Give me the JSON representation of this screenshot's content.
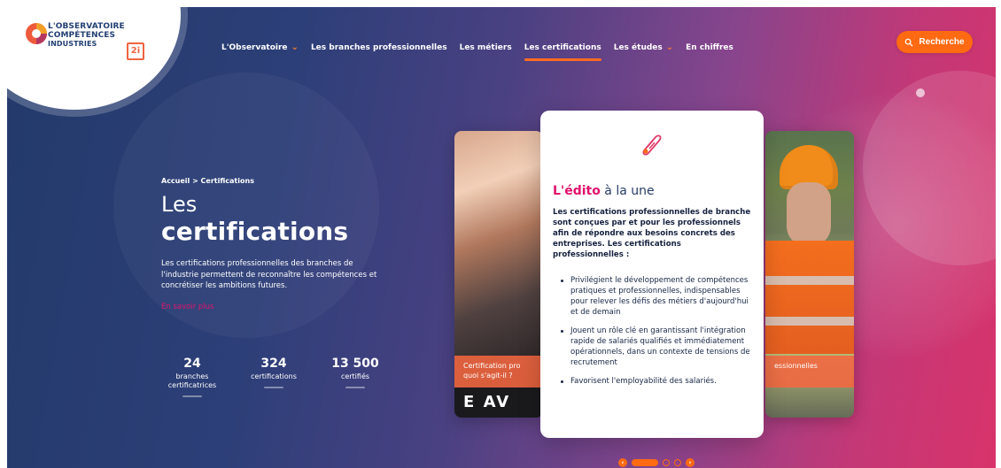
{
  "logo": {
    "line1": "L'OBSERVATOIRE",
    "line2": "COMPÉTENCES",
    "line3": "INDUSTRIES",
    "mark": "2i"
  },
  "nav": [
    {
      "label": "L'Observatoire",
      "has_chevron": true,
      "active": false
    },
    {
      "label": "Les branches professionnelles",
      "has_chevron": false,
      "active": false
    },
    {
      "label": "Les métiers",
      "has_chevron": false,
      "active": false
    },
    {
      "label": "Les certifications",
      "has_chevron": false,
      "active": true
    },
    {
      "label": "Les études",
      "has_chevron": true,
      "active": false
    },
    {
      "label": "En chiffres",
      "has_chevron": false,
      "active": false
    }
  ],
  "search": {
    "label": "Recherche",
    "icon": "search-icon"
  },
  "hero": {
    "breadcrumb": "Accueil > Certifications",
    "title_line1": "Les",
    "title_line2": "certifications",
    "intro": "Les certifications professionnelles des branches de l'industrie permettent de reconnaître les compétences et concrétiser les ambitions futures.",
    "link": "En savoir plus"
  },
  "stats": [
    {
      "value": "24",
      "label": "branches certificatrices"
    },
    {
      "value": "324",
      "label": "certifications"
    },
    {
      "value": "13 500",
      "label": "certifiés"
    }
  ],
  "cards": {
    "left_banner": "Certification pro quoi s'agit-il ?",
    "left_bottom": "E AV",
    "right_banner": "essionnelles"
  },
  "edito": {
    "heading_accent": "L'édito",
    "heading_rest": " à la une",
    "lead": "Les certifications professionnelles de branche sont conçues par et pour les professionnels afin de répondre aux besoins concrets des entreprises. Les certifications professionnelles :",
    "bullets": [
      "Privilégient le développement de compétences pratiques et professionnelles, indispensables pour relever les défis des métiers d'aujourd'hui et de demain",
      "Jouent un rôle clé en garantissant l'intégration rapide de salariés qualifiés et immédiatement opérationnels, dans un contexte de tensions de recrutement",
      "Favorisent l'employabilité des salariés."
    ]
  },
  "carousel": {
    "prev": "‹",
    "next": "›"
  },
  "colors": {
    "accent_orange": "#ff6a12",
    "accent_pink": "#e0126c",
    "navy": "#223f73"
  }
}
